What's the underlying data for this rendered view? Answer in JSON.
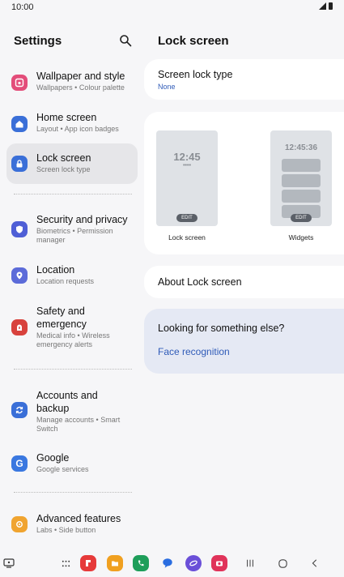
{
  "status": {
    "time": "10:00"
  },
  "left": {
    "title": "Settings",
    "items": [
      {
        "title": "Wallpaper and style",
        "sub": "Wallpapers • Colour palette",
        "color": "#e34d7a"
      },
      {
        "title": "Home screen",
        "sub": "Layout • App icon badges",
        "color": "#3a6fd8"
      },
      {
        "title": "Lock screen",
        "sub": "Screen lock type",
        "color": "#3a6fd8"
      },
      {
        "title": "Security and privacy",
        "sub": "Biometrics • Permission manager",
        "color": "#4f5fd6"
      },
      {
        "title": "Location",
        "sub": "Location requests",
        "color": "#5c6bd9"
      },
      {
        "title": "Safety and emergency",
        "sub": "Medical info • Wireless emergency alerts",
        "color": "#d8423d"
      },
      {
        "title": "Accounts and backup",
        "sub": "Manage accounts • Smart Switch",
        "color": "#3a6fd8"
      },
      {
        "title": "Google",
        "sub": "Google services",
        "color": "#3a78e0"
      },
      {
        "title": "Advanced features",
        "sub": "Labs • Side button",
        "color": "#f0a430"
      }
    ]
  },
  "right": {
    "title": "Lock screen",
    "lock_type_title": "Screen lock type",
    "lock_type_value": "None",
    "preview_lock_time": "12:45",
    "preview_lock_dots": "••••",
    "preview_widget_time": "12:45:36",
    "edit_label": "EDIT",
    "preview_lock_label": "Lock screen",
    "preview_widgets_label": "Widgets",
    "about": "About Lock screen",
    "looking_title": "Looking for something else?",
    "looking_link": "Face recognition"
  },
  "nav": {
    "apps": [
      {
        "name": "flipboard",
        "color": "#e63a3a"
      },
      {
        "name": "files",
        "color": "#f0a020"
      },
      {
        "name": "phone",
        "color": "#1e9e5a"
      },
      {
        "name": "messages",
        "color": "#2a6de0"
      },
      {
        "name": "internet",
        "color": "#6a4fd8"
      },
      {
        "name": "camera",
        "color": "#e0335a"
      }
    ]
  }
}
